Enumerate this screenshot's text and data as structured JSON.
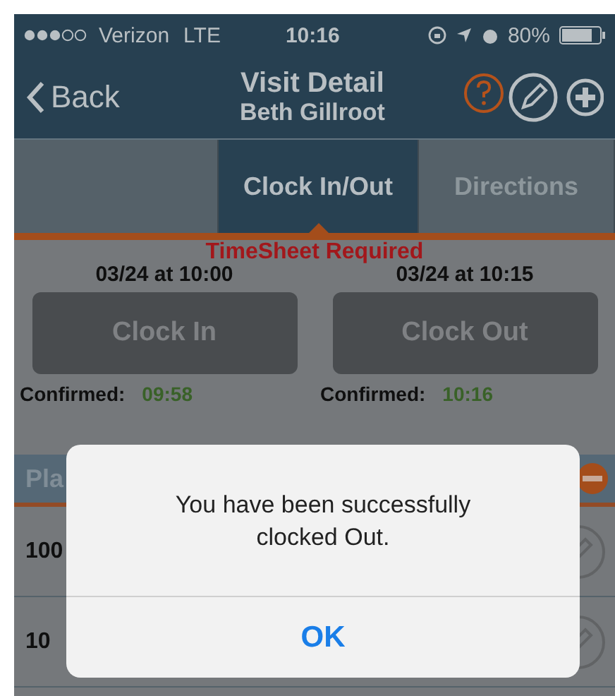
{
  "status_bar": {
    "carrier": "Verizon",
    "network": "LTE",
    "time": "10:16",
    "battery": "80%"
  },
  "nav": {
    "back": "Back",
    "title": "Visit Detail",
    "subtitle": "Beth Gillroot"
  },
  "tabs": [
    {
      "selected": false
    },
    {
      "label": "Clock In/Out",
      "selected": true
    },
    {
      "label": "Directions",
      "selected": false
    }
  ],
  "notice": "TimeSheet Required",
  "clock": [
    {
      "time": "03/24 at 10:00",
      "button": "Clock In",
      "confirmed_label": "Confirmed:",
      "confirmed_time": "09:58"
    },
    {
      "time": "03/24 at 10:15",
      "button": "Clock Out",
      "confirmed_label": "Confirmed:",
      "confirmed_time": "10:16"
    }
  ],
  "section": {
    "title": "Pla"
  },
  "rows": [
    "100",
    "10"
  ],
  "alert": {
    "message": "You have been successfully clocked Out.",
    "button": "OK"
  }
}
